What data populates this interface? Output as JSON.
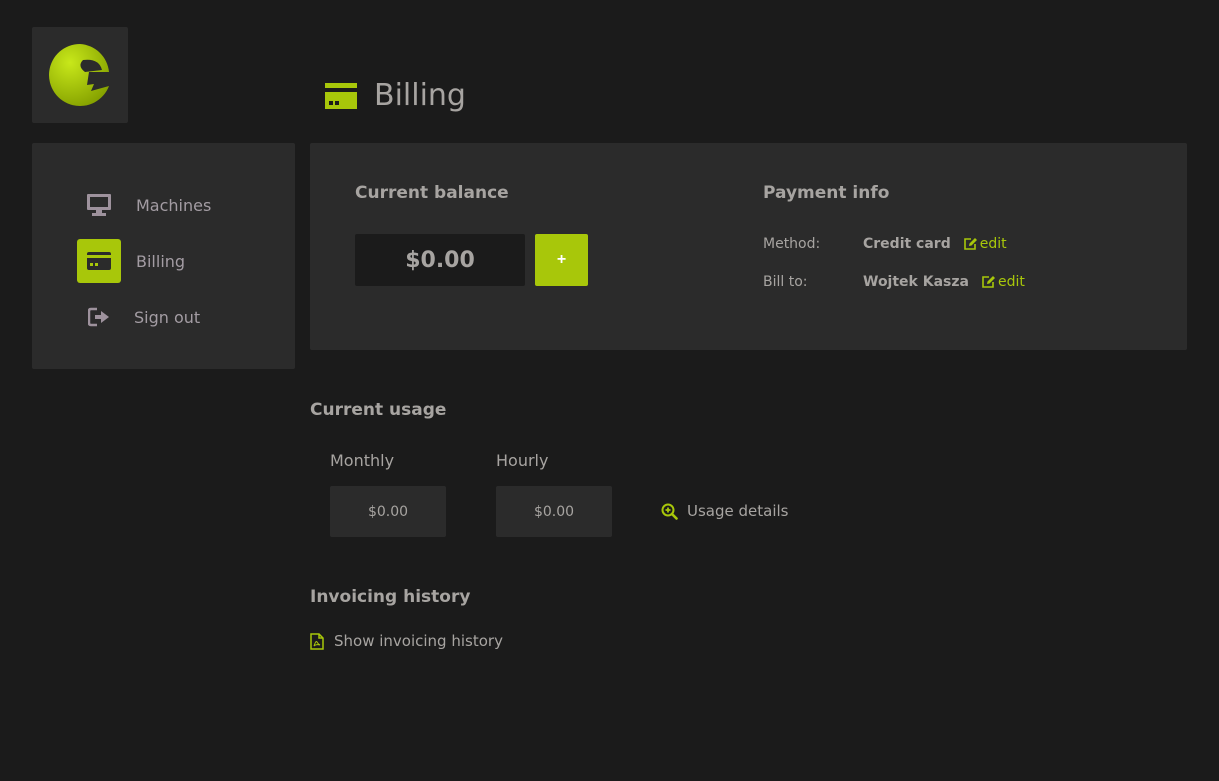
{
  "page": {
    "title": "Billing"
  },
  "sidebar": {
    "items": [
      {
        "label": "Machines",
        "icon": "monitor-icon"
      },
      {
        "label": "Billing",
        "icon": "credit-card-icon",
        "active": true
      },
      {
        "label": "Sign out",
        "icon": "sign-out-icon"
      }
    ]
  },
  "balance": {
    "heading": "Current balance",
    "amount": "$0.00",
    "add_label": "+"
  },
  "payment": {
    "heading": "Payment info",
    "method_label": "Method:",
    "method_value": "Credit card",
    "bill_to_label": "Bill to:",
    "bill_to_value": "Wojtek Kasza",
    "edit_label": "edit"
  },
  "usage": {
    "heading": "Current usage",
    "monthly_label": "Monthly",
    "monthly_value": "$0.00",
    "hourly_label": "Hourly",
    "hourly_value": "$0.00",
    "details_label": "Usage details"
  },
  "invoicing": {
    "heading": "Invoicing history",
    "show_label": "Show invoicing history"
  },
  "colors": {
    "accent": "#a8c70a",
    "panel": "#2b2b2b",
    "background": "#1b1b1b"
  }
}
